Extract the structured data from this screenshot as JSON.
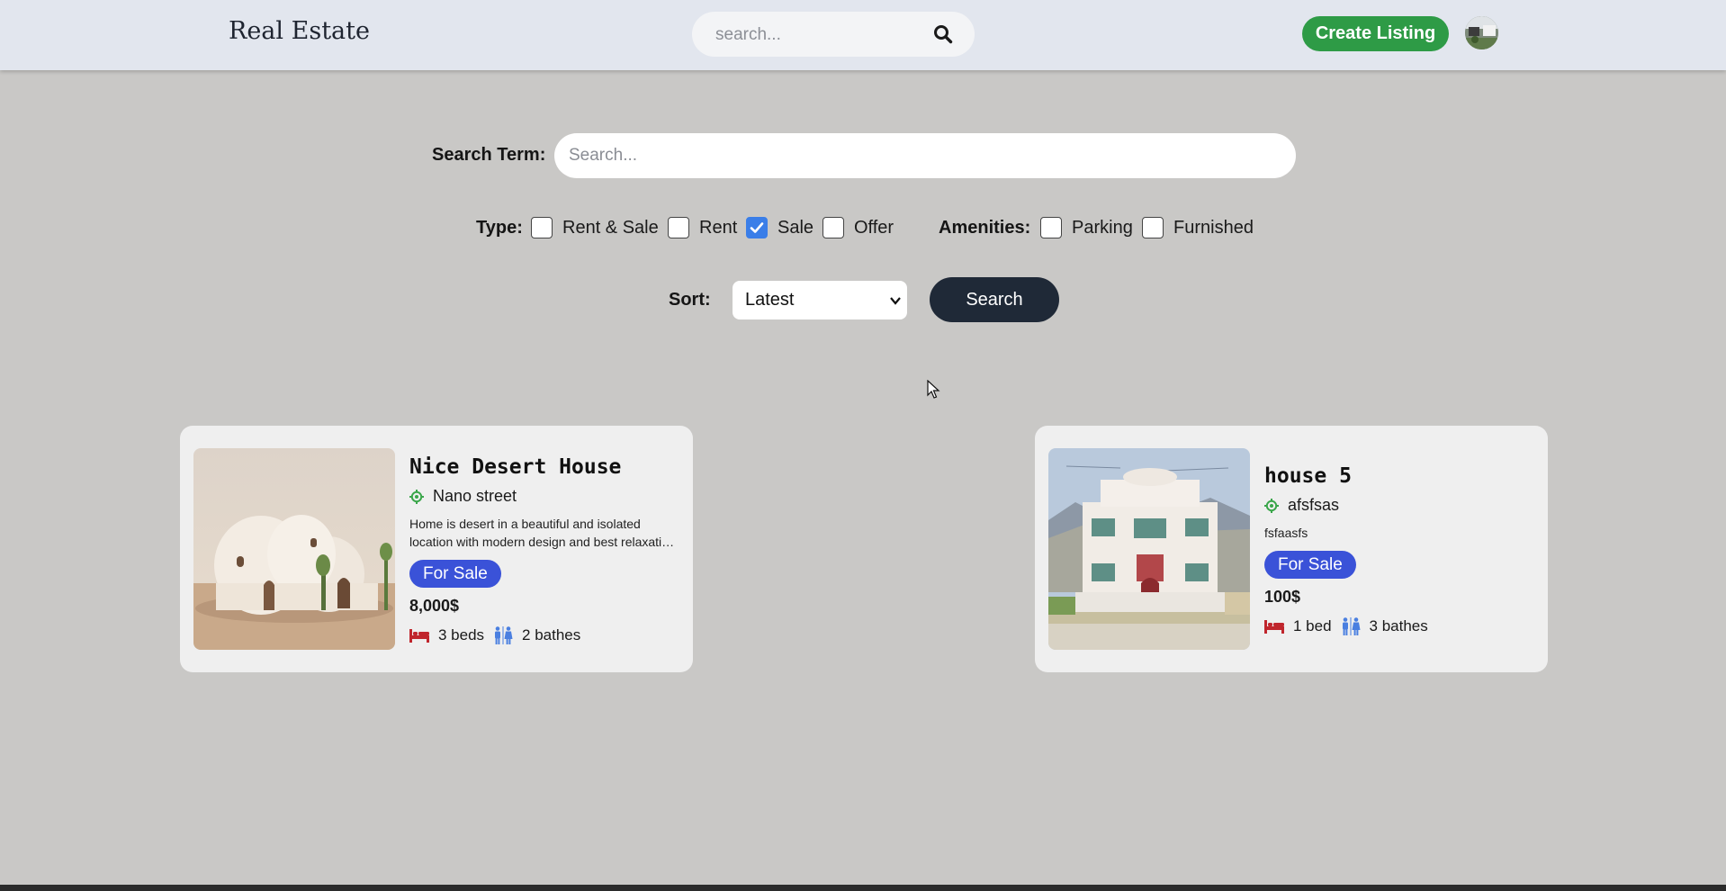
{
  "header": {
    "brand": "Real Estate",
    "search_placeholder": "search...",
    "create_listing": "Create Listing"
  },
  "filters": {
    "search_term_label": "Search Term:",
    "search_term_placeholder": "Search...",
    "type_label": "Type:",
    "types": [
      {
        "label": "Rent & Sale",
        "checked": false
      },
      {
        "label": "Rent",
        "checked": false
      },
      {
        "label": "Sale",
        "checked": true
      },
      {
        "label": "Offer",
        "checked": false
      }
    ],
    "amenities_label": "Amenities:",
    "amenities": [
      {
        "label": "Parking",
        "checked": false
      },
      {
        "label": "Furnished",
        "checked": false
      }
    ],
    "sort_label": "Sort:",
    "sort_value": "Latest",
    "search_button": "Search"
  },
  "listings": [
    {
      "title": "Nice Desert House",
      "address": "Nano street",
      "description": "Home is desert in a beautiful and isolated location with modern design and best relaxation experience",
      "badge": "For Sale",
      "price": "8,000$",
      "beds": "3 beds",
      "baths": "2 bathes"
    },
    {
      "title": "house 5",
      "address": "afsfsas",
      "description": "fsfaasfs",
      "badge": "For Sale",
      "price": "100$",
      "beds": "1 bed",
      "baths": "3 bathes"
    }
  ],
  "colors": {
    "page_bg": "#c9c8c6",
    "header_bg": "#e2e6ee",
    "create_btn": "#2e9b46",
    "search_btn": "#1f2937",
    "badge": "#3a52d8",
    "checkbox_checked": "#3a7ee8",
    "pin": "#3aa64a",
    "bed_icon": "#c0262d",
    "bath_icon": "#4a7fe0"
  }
}
